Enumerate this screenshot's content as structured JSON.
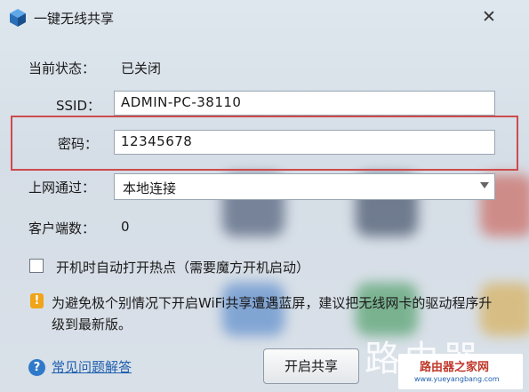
{
  "window": {
    "title": "一键无线共享",
    "close_glyph": "✕"
  },
  "status": {
    "label": "当前状态：",
    "value": "已关闭"
  },
  "ssid": {
    "label": "SSID：",
    "value": "ADMIN-PC-38110"
  },
  "password": {
    "label": "密码：",
    "value": "12345678"
  },
  "network": {
    "label": "上网通过：",
    "selected": "本地连接"
  },
  "clients": {
    "label": "客户端数：",
    "value": "0"
  },
  "autostart": {
    "label": "开机时自动打开热点（需要魔方开机启动）",
    "checked": false
  },
  "notice": {
    "text": "为避免极个别情况下开启WiFi共享遭遇蓝屏，建议把无线网卡的驱动程序升级到最新版。"
  },
  "help": {
    "link": "常见问题解答"
  },
  "action": {
    "button_label": "开启共享"
  },
  "watermark": {
    "text": "路由器",
    "site_name": "路由器之家网",
    "url": "www.yueyangbang.com"
  },
  "colors": {
    "highlight_border": "#cc4c4c",
    "link": "#1f5fae",
    "warning": "#f0a419"
  }
}
